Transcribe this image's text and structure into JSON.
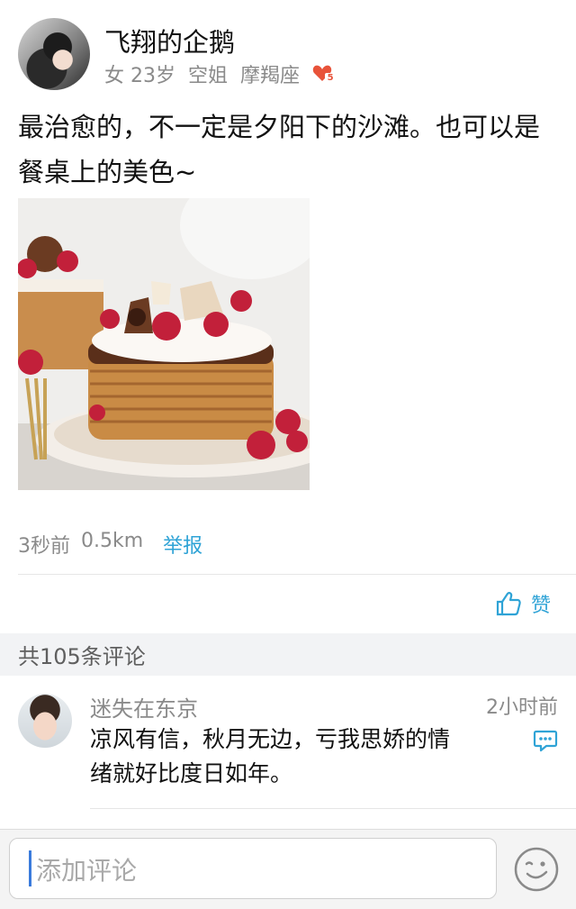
{
  "post": {
    "username": "飞翔的企鹅",
    "gender": "女",
    "age": "23岁",
    "occupation": "空姐",
    "zodiac": "摩羯座",
    "level": "5",
    "text": "最治愈的，不一定是夕阳下的沙滩。也可以是餐桌上的美色~",
    "time_ago": "3秒前",
    "distance": "0.5km",
    "report_label": "举报",
    "like_label": "赞"
  },
  "comments": {
    "count_label": "共105条评论",
    "items": [
      {
        "author": "迷失在东京",
        "time": "2小时前",
        "text": "凉风有信，秋月无边，亏我思娇的情绪就好比度日如年。"
      }
    ]
  },
  "composer": {
    "placeholder": "添加评论"
  },
  "colors": {
    "accent": "#2fa3d6",
    "badge": "#e8533a",
    "muted": "#8a8a8a"
  }
}
